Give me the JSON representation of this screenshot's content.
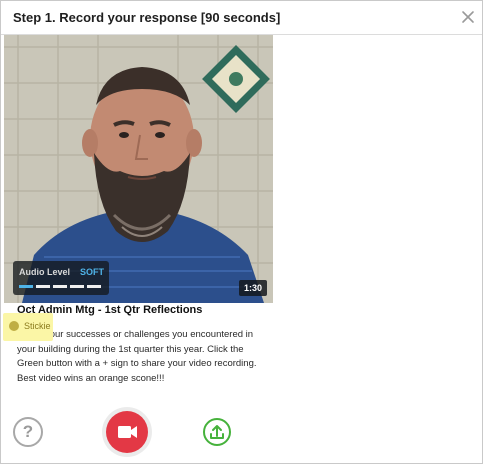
{
  "header": {
    "title": "Step 1. Record your response [90 seconds]",
    "close_icon": "close-icon"
  },
  "video": {
    "audio_label": "Audio Level",
    "audio_level": "SOFT",
    "meter_segments_active": 1,
    "meter_segments_total": 5,
    "timer": "1:30"
  },
  "prompt": {
    "title": "Oct Admin Mtg - 1st Qtr Reflections",
    "sticky_label": "Stickie",
    "body": "Share your successes or challenges you encountered in your building during the 1st quarter this year.  Click the Green button with a + sign to share your video recording.  Best video wins an orange scone!!!"
  },
  "controls": {
    "help_glyph": "?",
    "help_icon": "question-icon",
    "record_icon": "video-camera-icon",
    "upload_icon": "upload-icon"
  },
  "colors": {
    "record": "#e33845",
    "upload": "#46b23c",
    "audio_level": "#4fb3e8",
    "sticky_bg": "#fbf6a6"
  }
}
